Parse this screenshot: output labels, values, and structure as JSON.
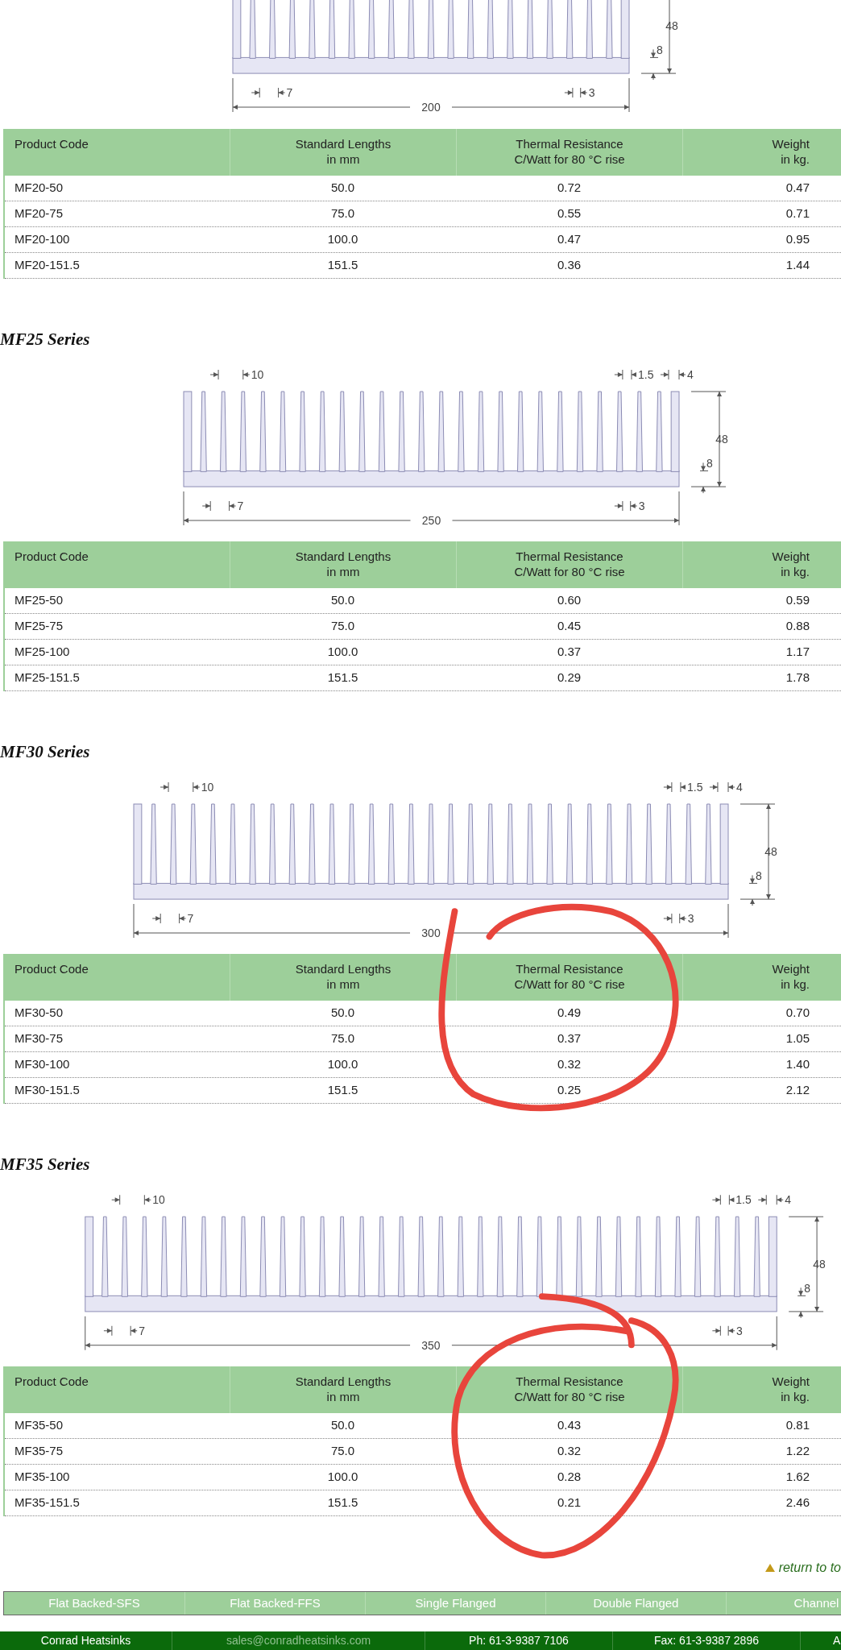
{
  "series": [
    {
      "drawing": {
        "height_label": "48",
        "base_label": "8",
        "bottom_labels": [
          "7",
          "3"
        ],
        "width_label": "200"
      },
      "columns": [
        "Product Code",
        "Standard Lengths\nin mm",
        "Thermal Resistance\nC/Watt for 80 °C rise",
        "Weight\nin kg."
      ],
      "rows": [
        [
          "MF20-50",
          "50.0",
          "0.72",
          "0.47"
        ],
        [
          "MF20-75",
          "75.0",
          "0.55",
          "0.71"
        ],
        [
          "MF20-100",
          "100.0",
          "0.47",
          "0.95"
        ],
        [
          "MF20-151.5",
          "151.5",
          "0.36",
          "1.44"
        ]
      ]
    },
    {
      "title": "MF25 Series",
      "drawing": {
        "top_labels": [
          "10",
          "1.5",
          "4"
        ],
        "height_label": "48",
        "base_label": "8",
        "bottom_labels": [
          "7",
          "3"
        ],
        "width_label": "250"
      },
      "columns": [
        "Product Code",
        "Standard Lengths\nin mm",
        "Thermal Resistance\nC/Watt for 80 °C rise",
        "Weight\nin kg."
      ],
      "rows": [
        [
          "MF25-50",
          "50.0",
          "0.60",
          "0.59"
        ],
        [
          "MF25-75",
          "75.0",
          "0.45",
          "0.88"
        ],
        [
          "MF25-100",
          "100.0",
          "0.37",
          "1.17"
        ],
        [
          "MF25-151.5",
          "151.5",
          "0.29",
          "1.78"
        ]
      ]
    },
    {
      "title": "MF30 Series",
      "drawing": {
        "top_labels": [
          "10",
          "1.5",
          "4"
        ],
        "height_label": "48",
        "base_label": "8",
        "bottom_labels": [
          "7",
          "3"
        ],
        "width_label": "300"
      },
      "columns": [
        "Product Code",
        "Standard Lengths\nin mm",
        "Thermal Resistance\nC/Watt for 80 °C rise",
        "Weight\nin kg."
      ],
      "rows": [
        [
          "MF30-50",
          "50.0",
          "0.49",
          "0.70"
        ],
        [
          "MF30-75",
          "75.0",
          "0.37",
          "1.05"
        ],
        [
          "MF30-100",
          "100.0",
          "0.32",
          "1.40"
        ],
        [
          "MF30-151.5",
          "151.5",
          "0.25",
          "2.12"
        ]
      ]
    },
    {
      "title": "MF35 Series",
      "drawing": {
        "top_labels": [
          "10",
          "1.5",
          "4"
        ],
        "height_label": "48",
        "base_label": "8",
        "bottom_labels": [
          "7",
          "3"
        ],
        "width_label": "350"
      },
      "columns": [
        "Product Code",
        "Standard Lengths\nin mm",
        "Thermal Resistance\nC/Watt for 80 °C rise",
        "Weight\nin kg."
      ],
      "rows": [
        [
          "MF35-50",
          "50.0",
          "0.43",
          "0.81"
        ],
        [
          "MF35-75",
          "75.0",
          "0.32",
          "1.22"
        ],
        [
          "MF35-100",
          "100.0",
          "0.28",
          "1.62"
        ],
        [
          "MF35-151.5",
          "151.5",
          "0.21",
          "2.46"
        ]
      ]
    }
  ],
  "return_link": "return to to",
  "nav": [
    "Flat Backed-SFS",
    "Flat Backed-FFS",
    "Single Flanged",
    "Double Flanged",
    "Channel"
  ],
  "footer": [
    {
      "kind": "text",
      "text": "Conrad Heatsinks"
    },
    {
      "kind": "link",
      "text": "sales@conradheatsinks.com"
    },
    {
      "kind": "text",
      "text": "Ph: 61-3-9387 7106"
    },
    {
      "kind": "text",
      "text": "Fax: 61-3-9387 2896"
    },
    {
      "kind": "text",
      "text": "A"
    }
  ]
}
